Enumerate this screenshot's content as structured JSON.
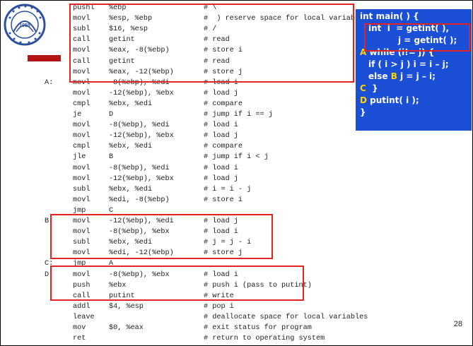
{
  "slide": {
    "page_number": "28"
  },
  "logo": {
    "year": "1958",
    "emblem_text": "中国科学技术大学 · University of Science and Technology of China"
  },
  "asm": [
    {
      "label": "",
      "op": "pushl",
      "arg": "%ebp",
      "cmt": "# \\"
    },
    {
      "label": "",
      "op": "movl",
      "arg": "%esp, %ebp",
      "cmt": "#  ) reserve space for local variables"
    },
    {
      "label": "",
      "op": "subl",
      "arg": "$16, %esp",
      "cmt": "# /"
    },
    {
      "label": "",
      "op": "call",
      "arg": "getint",
      "cmt": "# read"
    },
    {
      "label": "",
      "op": "movl",
      "arg": "%eax, -8(%ebp)",
      "cmt": "# store i"
    },
    {
      "label": "",
      "op": "call",
      "arg": "getint",
      "cmt": "# read"
    },
    {
      "label": "",
      "op": "movl",
      "arg": "%eax, -12(%ebp)",
      "cmt": "# store j"
    },
    {
      "label": "A:",
      "op": "movl",
      "arg": "-8(%ebp), %edi",
      "cmt": "# load i"
    },
    {
      "label": "",
      "op": "movl",
      "arg": "-12(%ebp), %ebx",
      "cmt": "# load j"
    },
    {
      "label": "",
      "op": "cmpl",
      "arg": "%ebx, %edi",
      "cmt": "# compare"
    },
    {
      "label": "",
      "op": "je",
      "arg": "D",
      "cmt": "# jump if i == j"
    },
    {
      "label": "",
      "op": "movl",
      "arg": "-8(%ebp), %edi",
      "cmt": "# load i"
    },
    {
      "label": "",
      "op": "movl",
      "arg": "-12(%ebp), %ebx",
      "cmt": "# load j"
    },
    {
      "label": "",
      "op": "cmpl",
      "arg": "%ebx, %edi",
      "cmt": "# compare"
    },
    {
      "label": "",
      "op": "jle",
      "arg": "B",
      "cmt": "# jump if i < j"
    },
    {
      "label": "",
      "op": "movl",
      "arg": "-8(%ebp), %edi",
      "cmt": "# load i"
    },
    {
      "label": "",
      "op": "movl",
      "arg": "-12(%ebp), %ebx",
      "cmt": "# load j"
    },
    {
      "label": "",
      "op": "subl",
      "arg": "%ebx, %edi",
      "cmt": "# i = i - j"
    },
    {
      "label": "",
      "op": "movl",
      "arg": "%edi, -8(%ebp)",
      "cmt": "# store i"
    },
    {
      "label": "",
      "op": "jmp",
      "arg": "C",
      "cmt": ""
    },
    {
      "label": "B:",
      "op": "movl",
      "arg": "-12(%ebp), %edi",
      "cmt": "# load j"
    },
    {
      "label": "",
      "op": "movl",
      "arg": "-8(%ebp), %ebx",
      "cmt": "# load i"
    },
    {
      "label": "",
      "op": "subl",
      "arg": "%ebx, %edi",
      "cmt": "# j = j - i"
    },
    {
      "label": "",
      "op": "movl",
      "arg": "%edi, -12(%ebp)",
      "cmt": "# store j"
    },
    {
      "label": "C:",
      "op": "jmp",
      "arg": "A",
      "cmt": ""
    },
    {
      "label": "D:",
      "op": "movl",
      "arg": "-8(%ebp), %ebx",
      "cmt": "# load i"
    },
    {
      "label": "",
      "op": "push",
      "arg": "%ebx",
      "cmt": "# push i (pass to putint)"
    },
    {
      "label": "",
      "op": "call",
      "arg": "putint",
      "cmt": "# write"
    },
    {
      "label": "",
      "op": "addl",
      "arg": "$4, %esp",
      "cmt": "# pop i"
    },
    {
      "label": "",
      "op": "leave",
      "arg": "",
      "cmt": "# deallocate space for local variables"
    },
    {
      "label": "",
      "op": "mov",
      "arg": "$0, %eax",
      "cmt": "# exit status for program"
    },
    {
      "label": "",
      "op": "ret",
      "arg": "",
      "cmt": "# return to operating system"
    }
  ],
  "c_code": {
    "line1": "int main( ) {",
    "line2": "int  i  = getint( ),",
    "line3": "j = getint( );",
    "line4_label": "A",
    "line4": " while (i!= j) {",
    "line5": "if ( i > j ) i = i – j;",
    "line6_pre": "else ",
    "line6_label": "B",
    "line6": " j = j – i;",
    "line7_label": "C",
    "line7": "  }",
    "line8_label": "D",
    "line8": " putint( i );",
    "line9": "}"
  },
  "colors": {
    "highlight": "#e02424",
    "code_box_bg": "#1a4fd6",
    "code_label": "#ffd400"
  }
}
